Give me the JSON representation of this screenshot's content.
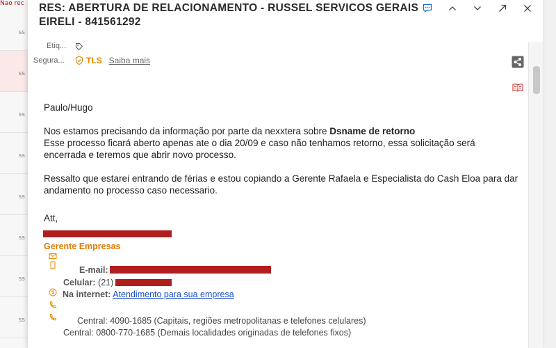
{
  "background": {
    "top_text": "Nao rec",
    "ticks": [
      "ss",
      "ss",
      "ss",
      "ss",
      "ss",
      "ss",
      "ss",
      "ss"
    ]
  },
  "email": {
    "subject": "RES: ABERTURA DE RELACIONAMENTO - RUSSEL SERVICOS GERAIS EIRELI - 841561292",
    "tags_label": "Etiq...",
    "security_label": "Segura...",
    "tls_text": "TLS",
    "learn_more": "Saiba mais",
    "body": {
      "greeting": "Paulo/Hugo",
      "p1_line1_a": "Nos estamos precisando da informação por parte da nexxtera sobre ",
      "p1_line1_b": "Dsname de retorno",
      "p1_line2": "Esse processo ficará aberto apenas ate o dia 20/09 e caso não tenhamos retorno, essa solicitação será encerrada e teremos que abrir novo processo.",
      "p2": "Ressalto que estarei entrando de férias e estou copiando a Gerente Rafaela e Especialista do Cash Eloa para dar andamento no processo caso necessario.",
      "closing": "Att,"
    },
    "signature": {
      "title": "Gerente Empresas",
      "email_label": "E-mail:",
      "phone_label": "Celular:",
      "phone_visible": "(21)",
      "internet_label": "Na internet:",
      "internet_link": "Atendimento para sua empresa",
      "central1": "Central: 4090-1685 (Capitais, regiões metropolitanas e telefones celulares)",
      "central2": "Central: 0800-770-1685 (Demais localidades originadas de telefones fixos)"
    }
  },
  "colors": {
    "accent_orange": "#e08a00",
    "redaction": "#b11e1e",
    "link": "#1a4fcc"
  },
  "icons": {
    "toolbar": [
      "chat-icon",
      "chevron-up-icon",
      "chevron-down-icon",
      "expand-icon",
      "close-icon"
    ],
    "meta": [
      "tag-icon",
      "shield-check-icon"
    ],
    "actions": [
      "share-icon",
      "immersive-reader-icon"
    ]
  }
}
